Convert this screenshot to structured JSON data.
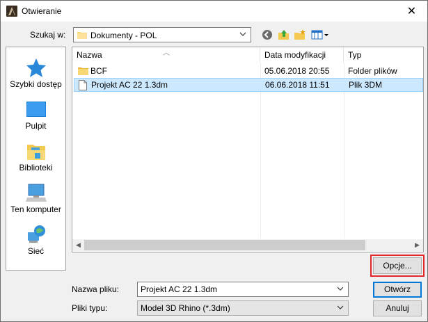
{
  "window": {
    "title": "Otwieranie",
    "close_glyph": "✕"
  },
  "lookin": {
    "label": "Szukaj w:",
    "value": "Dokumenty - POL"
  },
  "toolbar": {
    "icons": [
      "back-icon",
      "up-folder-icon",
      "new-folder-icon",
      "view-menu-icon"
    ]
  },
  "places": [
    {
      "label": "Szybki dostęp",
      "icon": "star-icon"
    },
    {
      "label": "Pulpit",
      "icon": "desktop-icon"
    },
    {
      "label": "Biblioteki",
      "icon": "libraries-icon"
    },
    {
      "label": "Ten komputer",
      "icon": "computer-icon"
    },
    {
      "label": "Sieć",
      "icon": "network-icon"
    }
  ],
  "columns": {
    "name": "Nazwa",
    "date": "Data modyfikacji",
    "type": "Typ"
  },
  "files": [
    {
      "name": "BCF",
      "date": "05.06.2018 20:55",
      "type": "Folder plików",
      "icon": "folder-icon"
    },
    {
      "name": "Projekt AC 22 1.3dm",
      "date": "06.06.2018 11:51",
      "type": "Plik 3DM",
      "icon": "file-icon",
      "selected": true
    }
  ],
  "filename": {
    "label": "Nazwa pliku:",
    "value": "Projekt AC 22 1.3dm"
  },
  "filetype": {
    "label": "Pliki typu:",
    "value": "Model 3D Rhino (*.3dm)"
  },
  "buttons": {
    "options": "Opcje...",
    "open": "Otwórz",
    "cancel": "Anuluj"
  },
  "colors": {
    "selection": "#cce8ff",
    "highlight": "#e0262b",
    "accent": "#0078d7"
  }
}
